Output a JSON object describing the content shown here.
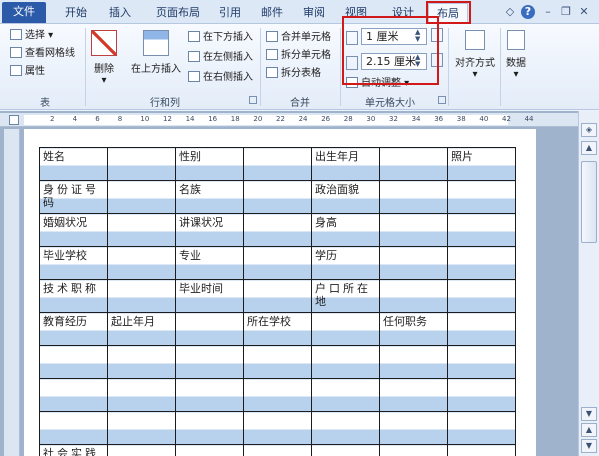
{
  "ribbon_tabs": [
    "文件",
    "开始",
    "插入",
    "页面布局",
    "引用",
    "邮件",
    "审阅",
    "视图",
    "设计",
    "布局"
  ],
  "groups": {
    "table": {
      "label": "表",
      "select": "选择",
      "gridlines": "查看网格线",
      "properties": "属性"
    },
    "rows_cols": {
      "label": "行和列",
      "delete": "删除",
      "insert_above": "在上方插入",
      "insert_below": "在下方插入",
      "insert_left": "在左侧插入",
      "insert_right": "在右侧插入"
    },
    "merge": {
      "label": "合并",
      "merge_cells": "合并单元格",
      "split_cells": "拆分单元格",
      "split_table": "拆分表格"
    },
    "cell_size": {
      "label": "单元格大小",
      "height": "1 厘米",
      "width": "2.15 厘米",
      "autofit": "自动调整"
    },
    "alignment": {
      "label": "对齐方式"
    },
    "data": {
      "label": "数据"
    }
  },
  "ruler_numbers": [
    "2",
    "4",
    "6",
    "8",
    "10",
    "12",
    "14",
    "16",
    "18",
    "20",
    "22",
    "24",
    "26",
    "28",
    "30",
    "32",
    "34",
    "36",
    "38",
    "40",
    "42",
    "44"
  ],
  "colors": {
    "highlight_red": "#d21919",
    "cell_shading": "#b8d2ee",
    "file_tab": "#2a5aa8"
  },
  "table": {
    "rows": [
      [
        "姓名",
        "",
        "性别",
        "",
        "出生年月",
        "",
        "照片"
      ],
      [
        "身份证号码",
        "",
        "名族",
        "",
        "政治面貌",
        "",
        ""
      ],
      [
        "婚姻状况",
        "",
        "讲课状况",
        "",
        "身高",
        "",
        ""
      ],
      [
        "毕业学校",
        "",
        "专业",
        "",
        "学历",
        "",
        ""
      ],
      [
        "技术职称",
        "",
        "毕业时间",
        "",
        "户口所在地",
        "",
        ""
      ],
      [
        "教育经历",
        "起止年月",
        "",
        "所在学校",
        "",
        "任何职务",
        ""
      ],
      [
        "",
        "",
        "",
        "",
        "",
        "",
        ""
      ],
      [
        "",
        "",
        "",
        "",
        "",
        "",
        ""
      ],
      [
        "",
        "",
        "",
        "",
        "",
        "",
        ""
      ],
      [
        "社会实践",
        "",
        "",
        "",
        "",
        "",
        ""
      ]
    ]
  }
}
